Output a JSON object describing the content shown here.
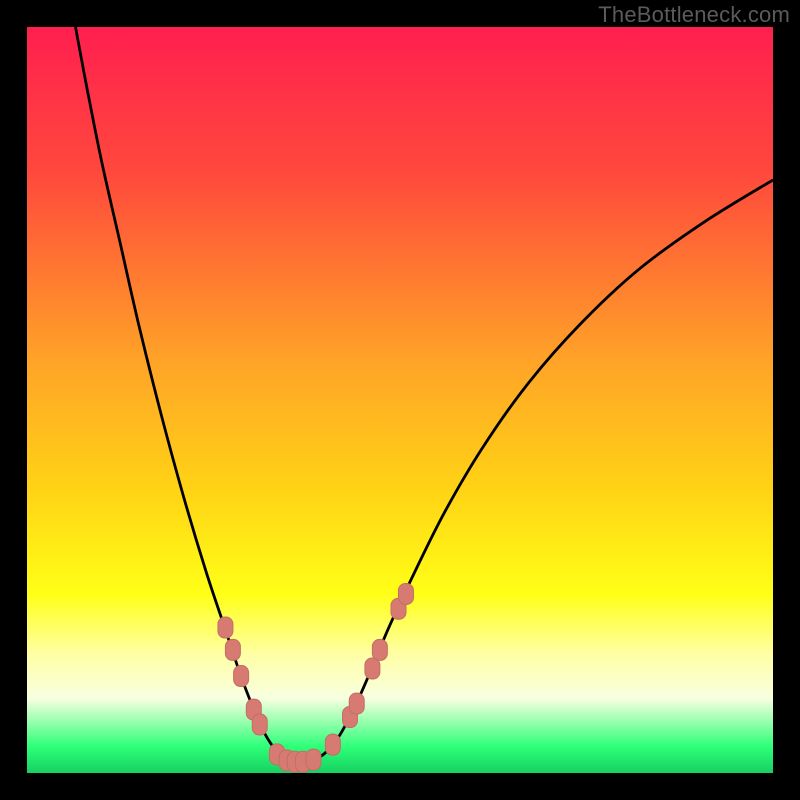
{
  "watermark": "TheBottleneck.com",
  "colors": {
    "frame": "#000000",
    "curve": "#000000",
    "marker_fill": "#d67a72",
    "marker_stroke": "#c46e66"
  },
  "chart_data": {
    "type": "line",
    "title": "",
    "xlabel": "",
    "ylabel": "",
    "xlim": [
      0,
      100
    ],
    "ylim": [
      0,
      100
    ],
    "gradient_stops": [
      {
        "offset": 0.0,
        "color": "#ff1f4f"
      },
      {
        "offset": 0.2,
        "color": "#ff4a3c"
      },
      {
        "offset": 0.45,
        "color": "#ffa427"
      },
      {
        "offset": 0.62,
        "color": "#ffd315"
      },
      {
        "offset": 0.76,
        "color": "#ffff17"
      },
      {
        "offset": 0.84,
        "color": "#ffffa4"
      },
      {
        "offset": 0.9,
        "color": "#f8ffe0"
      },
      {
        "offset": 0.965,
        "color": "#2dff78"
      },
      {
        "offset": 1.0,
        "color": "#17d061"
      }
    ],
    "curve_points": [
      {
        "x": 6.5,
        "y": 100.0
      },
      {
        "x": 8.0,
        "y": 92.0
      },
      {
        "x": 10.0,
        "y": 82.0
      },
      {
        "x": 12.5,
        "y": 71.0
      },
      {
        "x": 15.0,
        "y": 60.0
      },
      {
        "x": 18.0,
        "y": 48.0
      },
      {
        "x": 21.0,
        "y": 37.0
      },
      {
        "x": 24.0,
        "y": 27.0
      },
      {
        "x": 26.5,
        "y": 19.5
      },
      {
        "x": 28.5,
        "y": 13.5
      },
      {
        "x": 30.0,
        "y": 9.5
      },
      {
        "x": 31.5,
        "y": 6.0
      },
      {
        "x": 33.0,
        "y": 3.5
      },
      {
        "x": 34.5,
        "y": 2.0
      },
      {
        "x": 36.0,
        "y": 1.5
      },
      {
        "x": 37.5,
        "y": 1.5
      },
      {
        "x": 39.0,
        "y": 2.0
      },
      {
        "x": 40.5,
        "y": 3.2
      },
      {
        "x": 42.0,
        "y": 5.2
      },
      {
        "x": 44.0,
        "y": 9.0
      },
      {
        "x": 46.0,
        "y": 13.5
      },
      {
        "x": 48.5,
        "y": 19.5
      },
      {
        "x": 52.0,
        "y": 27.0
      },
      {
        "x": 56.0,
        "y": 35.0
      },
      {
        "x": 61.0,
        "y": 43.5
      },
      {
        "x": 67.0,
        "y": 52.0
      },
      {
        "x": 74.0,
        "y": 60.0
      },
      {
        "x": 82.0,
        "y": 67.5
      },
      {
        "x": 91.0,
        "y": 74.0
      },
      {
        "x": 100.0,
        "y": 79.5
      }
    ],
    "markers": [
      {
        "x": 26.6,
        "y": 19.5
      },
      {
        "x": 27.6,
        "y": 16.5
      },
      {
        "x": 28.7,
        "y": 13.0
      },
      {
        "x": 30.4,
        "y": 8.5
      },
      {
        "x": 31.2,
        "y": 6.5
      },
      {
        "x": 33.5,
        "y": 2.5
      },
      {
        "x": 34.8,
        "y": 1.7
      },
      {
        "x": 35.9,
        "y": 1.5
      },
      {
        "x": 37.0,
        "y": 1.5
      },
      {
        "x": 38.4,
        "y": 1.8
      },
      {
        "x": 41.0,
        "y": 3.8
      },
      {
        "x": 43.3,
        "y": 7.5
      },
      {
        "x": 44.2,
        "y": 9.3
      },
      {
        "x": 46.3,
        "y": 14.0
      },
      {
        "x": 47.3,
        "y": 16.5
      },
      {
        "x": 49.8,
        "y": 22.0
      },
      {
        "x": 50.8,
        "y": 24.0
      }
    ]
  }
}
